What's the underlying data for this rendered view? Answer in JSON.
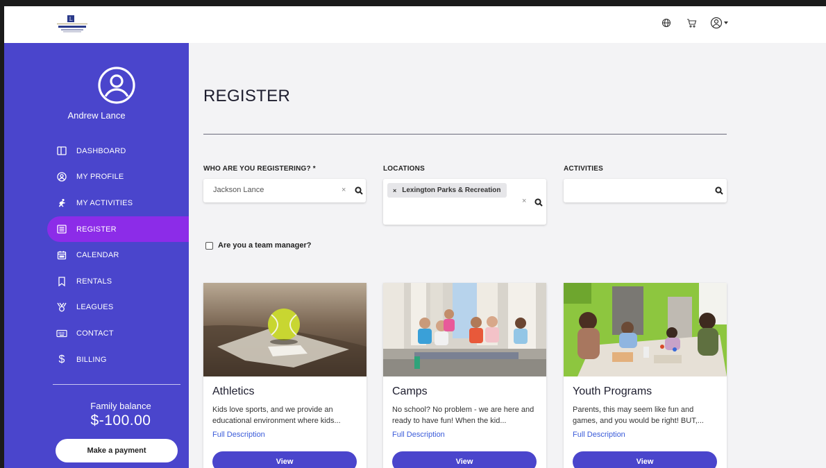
{
  "header": {
    "logo_alt": "LEXINGTON",
    "icons": [
      "globe-icon",
      "cart-icon",
      "account-icon"
    ]
  },
  "sidebar": {
    "user_name": "Andrew Lance",
    "items": [
      {
        "label": "DASHBOARD",
        "icon": "dashboard-icon"
      },
      {
        "label": "MY PROFILE",
        "icon": "profile-icon"
      },
      {
        "label": "MY ACTIVITIES",
        "icon": "activities-icon"
      },
      {
        "label": "REGISTER",
        "icon": "register-icon",
        "active": true
      },
      {
        "label": "CALENDAR",
        "icon": "calendar-icon"
      },
      {
        "label": "RENTALS",
        "icon": "bookmark-icon"
      },
      {
        "label": "LEAGUES",
        "icon": "trophy-icon"
      },
      {
        "label": "CONTACT",
        "icon": "keyboard-icon"
      },
      {
        "label": "BILLING",
        "icon": "dollar-icon"
      }
    ],
    "balance_label": "Family balance",
    "balance_amount": "$-100.00",
    "pay_label": "Make a payment"
  },
  "main": {
    "title": "REGISTER",
    "who": {
      "label": "WHO ARE YOU REGISTERING? *",
      "value": "Jackson Lance"
    },
    "locations": {
      "label": "LOCATIONS",
      "chip": "Lexington Parks & Recreation"
    },
    "activities": {
      "label": "ACTIVITIES",
      "value": ""
    },
    "team_manager_label": "Are you a team manager?",
    "cards": [
      {
        "title": "Athletics",
        "desc": "Kids love sports, and we provide an educational environment where kids...",
        "link": "Full Description",
        "button": "View"
      },
      {
        "title": "Camps",
        "desc": "No school? No problem - we are here and ready to have fun! When the kid...",
        "link": "Full Description",
        "button": "View"
      },
      {
        "title": "Youth Programs",
        "desc": "Parents, this may seem like fun and games, and you would be right! BUT,...",
        "link": "Full Description",
        "button": "View"
      }
    ]
  },
  "colors": {
    "sidebar": "#4a45cc",
    "active": "#8c2ce8",
    "link": "#3a5bd9",
    "button": "#4a45cc"
  }
}
